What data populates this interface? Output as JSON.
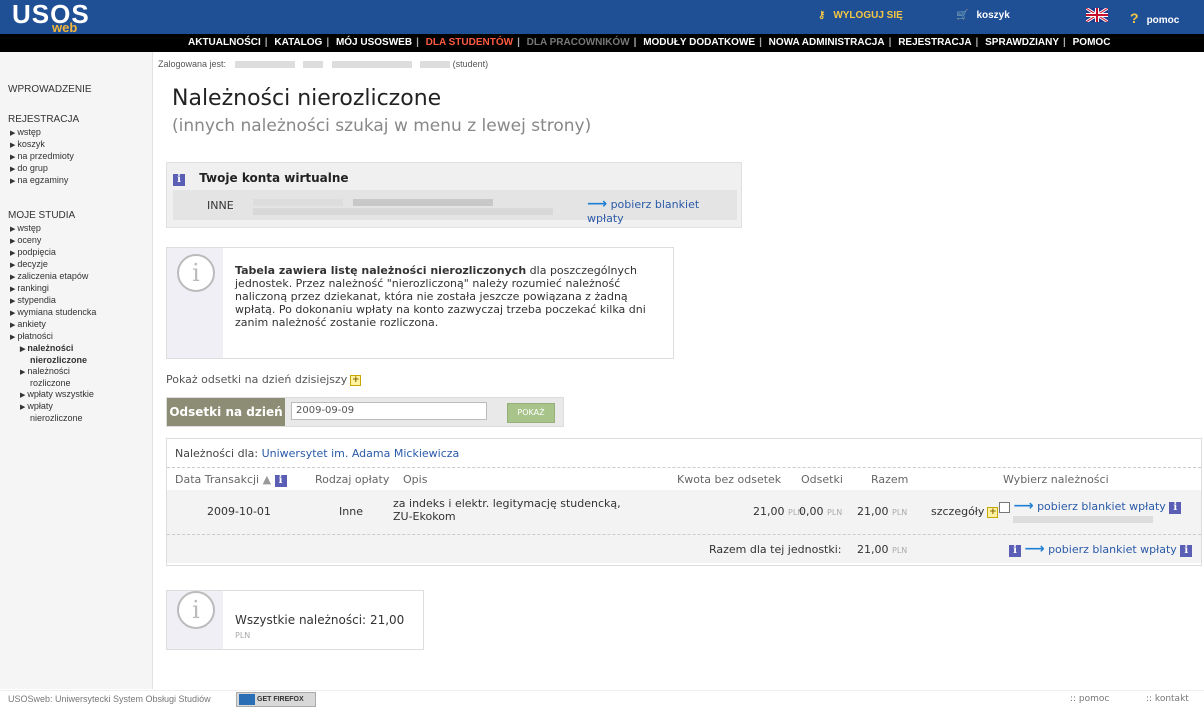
{
  "header": {
    "logo": "USOS",
    "logo_sub": "web",
    "logout": "WYLOGUJ SIĘ",
    "cart": "koszyk",
    "help": "pomoc"
  },
  "nav": {
    "items": [
      "AKTUALNOŚCI",
      "KATALOG",
      "MÓJ USOSWEB",
      "DLA STUDENTÓW",
      "DLA PRACOWNIKÓW",
      "MODUŁY DODATKOWE",
      "NOWA ADMINISTRACJA",
      "REJESTRACJA",
      "SPRAWDZIANY",
      "POMOC"
    ]
  },
  "logged": {
    "label": "Zalogowana jest:",
    "role": "(student)"
  },
  "sidebar": {
    "intro": "WPROWADZENIE",
    "reg_head": "REJESTRACJA",
    "reg_items": [
      "wstęp",
      "koszyk",
      "na przedmioty",
      "do grup",
      "na egzaminy"
    ],
    "studies_head": "MOJE STUDIA",
    "studies_items": [
      "wstęp",
      "oceny",
      "podpięcia",
      "decyzje",
      "zaliczenia etapów",
      "rankingi",
      "stypendia",
      "wymiana studencka",
      "ankiety",
      "płatności"
    ],
    "pay_active_1": "należności",
    "pay_active_2": "nierozliczone",
    "pay_b_1": "należności",
    "pay_b_2": "rozliczone",
    "pay_c": "wpłaty wszystkie",
    "pay_d_1": "wpłaty",
    "pay_d_2": "nierozliczone"
  },
  "page": {
    "title": "Należności nierozliczone",
    "subtitle": "(innych należności szukaj w menu z lewej strony)"
  },
  "virtual": {
    "heading": "Twoje konta wirtualne",
    "account_type": "INNE",
    "download": "pobierz blankiet wpłaty"
  },
  "info": {
    "bold": "Tabela zawiera listę należności nierozliczonych",
    "text": " dla poszczególnych jednostek. Przez należność \"nierozliczoną\" należy rozumieć należność naliczoną przez dziekanat, która nie została jeszcze powiązana z żadną wpłatą. Po dokonaniu wpłaty na konto zazwyczaj trzeba poczekać kilka dni zanim należność zostanie rozliczona."
  },
  "interest": {
    "show": "Pokaż odsetki na dzień dzisiejszy",
    "label": "Odsetki na dzień",
    "date": "2009-09-09",
    "button": "POKAŻ"
  },
  "table": {
    "unit_label": "Należności dla:",
    "unit": "Uniwersytet im. Adama Mickiewicza",
    "headers": {
      "date": "Data Transakcji",
      "type": "Rodzaj opłaty",
      "desc": "Opis",
      "amount": "Kwota bez odsetek",
      "interest": "Odsetki",
      "total": "Razem",
      "choose": "Wybierz należności"
    },
    "row": {
      "date": "2009-10-01",
      "type": "Inne",
      "desc_1": "za indeks i elektr. legitymację studencką,",
      "desc_2": "ZU-Ekokom",
      "amount": "21,00",
      "interest": "0,00",
      "total": "21,00",
      "details": "szczegóły",
      "download": "pobierz blankiet wpłaty"
    },
    "sum_label": "Razem dla tej jednostki:",
    "sum": "21,00",
    "sum_download": "pobierz blankiet wpłaty",
    "currency": "PLN"
  },
  "summary": {
    "label": "Wszystkie należności:",
    "value": "21,00",
    "currency": "PLN"
  },
  "footer": {
    "left": "USOSweb: Uniwersytecki System Obsługi Studiów",
    "badge": "GET FIREFOX",
    "help": ":: pomoc",
    "contact": ":: kontakt"
  },
  "colors": {
    "topbar": "#1f4f95",
    "accent_orange": "#f3b63a",
    "nav_active": "#ff5a40",
    "link": "#2a5aa8"
  }
}
